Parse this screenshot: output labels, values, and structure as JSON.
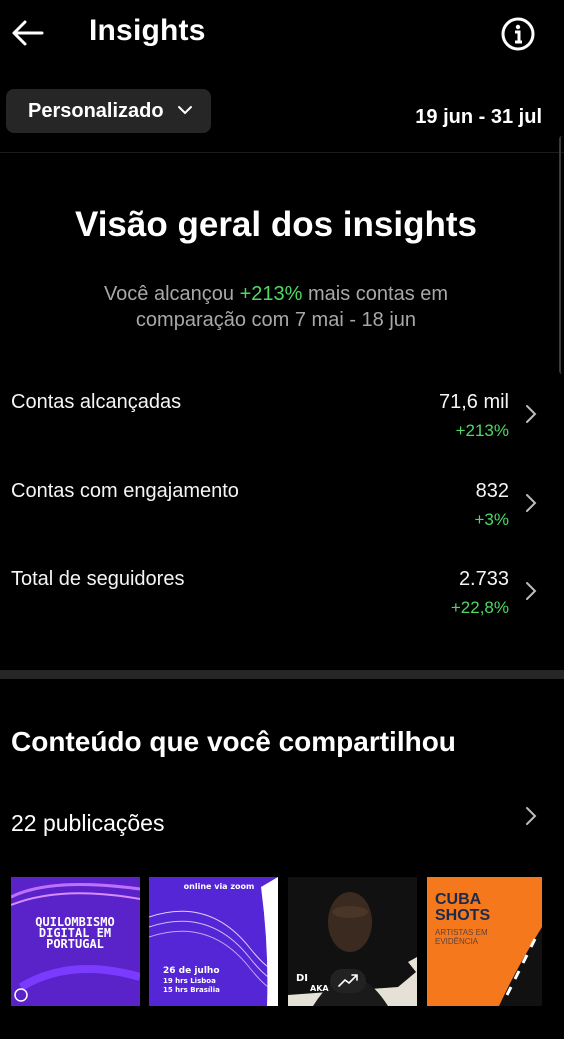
{
  "header": {
    "title": "Insights"
  },
  "filter": {
    "label": "Personalizado",
    "date_range": "19 jun - 31 jul"
  },
  "overview": {
    "title": "Visão geral dos insights",
    "subtitle_prefix": "Você alcançou ",
    "subtitle_highlight": "+213%",
    "subtitle_suffix": " mais contas em comparação com 7 mai - 18 jun"
  },
  "metrics": [
    {
      "label": "Contas alcançadas",
      "value": "71,6 mil",
      "change": "+213%"
    },
    {
      "label": "Contas com engajamento",
      "value": "832",
      "change": "+3%"
    },
    {
      "label": "Total de seguidores",
      "value": "2.733",
      "change": "+22,8%"
    }
  ],
  "content": {
    "title": "Conteúdo que você compartilhou",
    "publications": "22 publicações",
    "posts": [
      {
        "lines": [
          "QUILOMBISMO",
          "DIGITAL EM",
          "PORTUGAL"
        ]
      },
      {
        "top": "online via zoom",
        "date": "26 de julho",
        "time1": "19 hrs Lisboa",
        "time2": "15 hrs Brasília"
      },
      {
        "caption": "DI",
        "caption2": "AKA"
      },
      {
        "title1": "CUBA",
        "title2": "SHOTS",
        "sub1": "ARTISTAS EM",
        "sub2": "EVIDÊNCIA"
      }
    ]
  },
  "colors": {
    "accent_green": "#4cd964",
    "pill_bg": "#262626",
    "muted": "#a8a8a8"
  },
  "icons": [
    "back-arrow-icon",
    "info-icon",
    "chevron-down-icon",
    "chevron-right-icon",
    "trending-icon"
  ]
}
